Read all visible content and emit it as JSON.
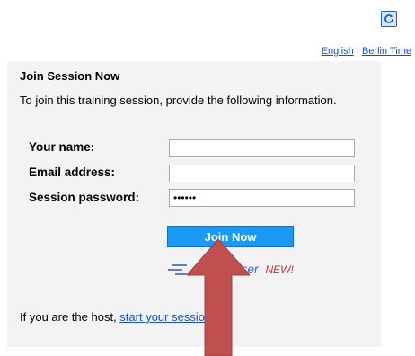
{
  "header": {
    "refresh_icon": "refresh-icon",
    "language_link": "English",
    "separator": " : ",
    "timezone_link": "Berlin Time"
  },
  "panel": {
    "title": "Join Session Now",
    "instructions": "To join this training session, provide the following information."
  },
  "form": {
    "name_label": "Your name:",
    "name_value": "",
    "email_label": "Email address:",
    "email_value": "",
    "password_label": "Session password:",
    "password_value": "••••••"
  },
  "join_button_label": "Join Now",
  "browser_option": {
    "icon": "browser-lines-icon",
    "text": "Browser",
    "badge": "NEW!"
  },
  "host": {
    "prefix": "If you are the host, ",
    "link": "start your session",
    "suffix": "."
  },
  "colors": {
    "join_button": "#1a9af5",
    "link": "#1a4fc4",
    "new_badge": "#e0241a",
    "arrow": "#c0504d",
    "panel_bg": "#f3f3f3"
  }
}
